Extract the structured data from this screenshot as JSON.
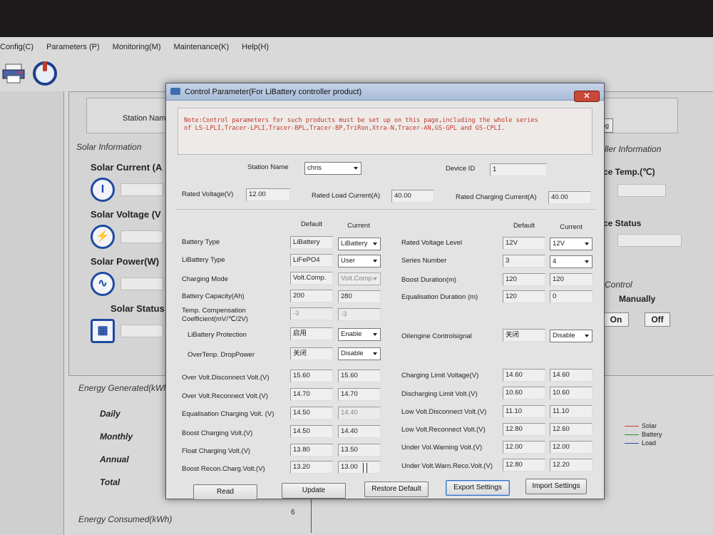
{
  "menu": [
    "Config(C)",
    "Parameters (P)",
    "Monitoring(M)",
    "Maintenance(K)",
    "Help(H)"
  ],
  "background": {
    "station_label": "Station Name",
    "monitoring_button": "Monitoring",
    "solar_group_title": "Solar Information",
    "solar_current": "Solar Current (A",
    "solar_voltage": "Solar Voltage (V",
    "solar_power": "Solar Power(W)",
    "solar_status": "Solar Status",
    "controller_group_title": "ller Information",
    "temp_label": "ce Temp.(℃)",
    "status_label": "ce Status",
    "control_title": "Control",
    "manually_label": "Manually",
    "on_button": "On",
    "off_button": "Off",
    "energy_generated_title": "Energy Generated(kWh",
    "daily": "Daily",
    "monthly": "Monthly",
    "annual": "Annual",
    "total": "Total",
    "energy_consumed_title": "Energy Consumed(kWh)",
    "axis_six": "6",
    "legend": [
      {
        "name": "Solar",
        "color": "#d23b2f"
      },
      {
        "name": "Battery",
        "color": "#2f8a3a"
      },
      {
        "name": "Load",
        "color": "#2f4fb0"
      }
    ]
  },
  "dialog": {
    "title": "Control Parameter(For LiBattery controller product)",
    "close_label": "✕",
    "note_line1": "Note:Control parameters for such products must be set up on this page,including the whole series",
    "note_line2": "of LS-LPLI,Tracer-LPLI,Tracer-BPL,Tracer-BP,TriRon,Xtra-N,Tracer-AN,GS-GPL and GS-CPLI.",
    "station_name_label": "Station Name",
    "station_name_value": "chris",
    "device_id_label": "Device ID",
    "device_id_value": "1",
    "rated_voltage_label": "Rated Voltage(V)",
    "rated_voltage_value": "12.00",
    "rated_load_label": "Rated Load Current(A)",
    "rated_load_value": "40.00",
    "rated_charging_label": "Rated Charging Current(A)",
    "rated_charging_value": "40.00",
    "default_header": "Default",
    "current_header": "Current",
    "left_rows": [
      {
        "label": "Battery Type",
        "default": "LiBattery",
        "current": "LiBattery"
      },
      {
        "label": "LiBattery Type",
        "default": "LiFePO4",
        "current": "User"
      },
      {
        "label": "Charging Mode",
        "default": "Volt.Comp.",
        "current": "Volt.Comp."
      },
      {
        "label": "Battery Capacity(Ah)",
        "default": "200",
        "current": "280"
      },
      {
        "label1": "Temp. Compensation",
        "label2": "Coefficient(mV/℃/2V)",
        "default": "-3",
        "current": "-3"
      },
      {
        "label": "LiBattery Protection",
        "default": "启用",
        "current": "Enable"
      },
      {
        "label": "OverTenp. DropPower",
        "default": "关闭",
        "current": "Disable"
      }
    ],
    "right_rows": [
      {
        "label": "Rated Voltage Level",
        "default": "12V",
        "current": "12V"
      },
      {
        "label": "Series Number",
        "default": "3",
        "current": "4"
      },
      {
        "label": "Boost Duration(m)",
        "default": "120",
        "current": "120"
      },
      {
        "label": "Equalisation Duration (m)",
        "default": "120",
        "current": "0"
      },
      {
        "label": "OiIengine Controlsignal",
        "default": "关闭",
        "current": "Disable"
      }
    ],
    "left_volt_rows": [
      {
        "label": "Over Volt.Disconnect Volt.(V)",
        "default": "15.60",
        "current": "15.60"
      },
      {
        "label": "Over Volt.Reconnect Volt.(V)",
        "default": "14.70",
        "current": "14.70"
      },
      {
        "label": "Equalisation Charging Volt. (V)",
        "default": "14.50",
        "current": "14.40"
      },
      {
        "label": "Boost Charging Volt.(V)",
        "default": "14.50",
        "current": "14.40"
      },
      {
        "label": "Float Charging Volt.(V)",
        "default": "13.80",
        "current": "13.50"
      },
      {
        "label": "Boost Recon.Charg.Volt.(V)",
        "default": "13.20",
        "current": "13.00"
      }
    ],
    "right_volt_rows": [
      {
        "label": "Charging Limit Voltage(V)",
        "default": "14.60",
        "current": "14.60"
      },
      {
        "label": "Discharging Limit Volt.(V)",
        "default": "10.60",
        "current": "10.60"
      },
      {
        "label": "Low Volt.Disconnect Volt.(V)",
        "default": "11.10",
        "current": "11.10"
      },
      {
        "label": "Low Volt.Reconnect Volt.(V)",
        "default": "12.80",
        "current": "12.60"
      },
      {
        "label": "Under Vol.Warning Volt.(V)",
        "default": "12.00",
        "current": "12.00"
      },
      {
        "label": "Under Volt.Warn.Reco.Volt.(V)",
        "default": "12.80",
        "current": "12.20"
      }
    ],
    "buttons": {
      "read": "Read",
      "update": "Update",
      "restore": "Restore Default",
      "export": "Export Settings",
      "import": "Import Settings"
    }
  }
}
